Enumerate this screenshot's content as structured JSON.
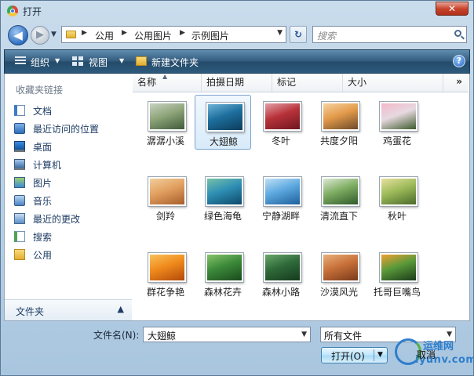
{
  "window": {
    "title": "打开",
    "close_glyph": "✕"
  },
  "nav_buttons": {
    "back_glyph": "◀",
    "forward_glyph": "▶",
    "history_glyph": "▼"
  },
  "address": {
    "arrow_glyph": "▶",
    "crumbs": [
      "公用",
      "公用图片",
      "示例图片"
    ],
    "dropdown_glyph": "▼",
    "refresh_glyph": "↻"
  },
  "search": {
    "placeholder": "搜索"
  },
  "toolbar": {
    "organize_label": "组织",
    "view_label": "视图",
    "new_folder_label": "新建文件夹",
    "caret_glyph": "▼",
    "help_glyph": "?"
  },
  "nav_pane": {
    "favorites_header": "收藏夹链接",
    "items": [
      {
        "label": "文档",
        "icon": "documents-icon"
      },
      {
        "label": "最近访问的位置",
        "icon": "recent-places-icon"
      },
      {
        "label": "桌面",
        "icon": "desktop-icon"
      },
      {
        "label": "计算机",
        "icon": "computer-icon"
      },
      {
        "label": "图片",
        "icon": "pictures-icon"
      },
      {
        "label": "音乐",
        "icon": "music-icon"
      },
      {
        "label": "最近的更改",
        "icon": "recent-changes-icon"
      },
      {
        "label": "搜索",
        "icon": "searches-icon"
      },
      {
        "label": "公用",
        "icon": "public-folder-icon"
      }
    ],
    "folders_label": "文件夹",
    "folders_caret": "▲"
  },
  "columns": {
    "headers": [
      "名称",
      "拍摄日期",
      "标记",
      "大小"
    ],
    "sort_glyph": "▲",
    "more_glyph": "»"
  },
  "files": [
    {
      "name": "潺潺小溪",
      "colors": [
        "#8fa57a",
        "#3f5b3a",
        "#c7d2c1"
      ]
    },
    {
      "name": "大翅鲸",
      "colors": [
        "#1e6f9e",
        "#0c3c5c",
        "#6fb4d8"
      ],
      "selected": true
    },
    {
      "name": "冬叶",
      "colors": [
        "#b8323a",
        "#6e1620",
        "#e3a0a6"
      ]
    },
    {
      "name": "共度夕阳",
      "colors": [
        "#e39a4a",
        "#6d4a2a",
        "#f6d3a0"
      ]
    },
    {
      "name": "鸡蛋花",
      "colors": [
        "#e7d9e0",
        "#3d5a2c",
        "#f2b8c8"
      ]
    },
    {
      "name": "剑羚",
      "colors": [
        "#e2a060",
        "#a85d2b",
        "#f1cf9d"
      ]
    },
    {
      "name": "绿色海龟",
      "colors": [
        "#2f8fb5",
        "#0d4a6a",
        "#77c2a8"
      ]
    },
    {
      "name": "宁静湖畔",
      "colors": [
        "#5da9df",
        "#1f5f9c",
        "#bfe0f5"
      ]
    },
    {
      "name": "清流直下",
      "colors": [
        "#7fae63",
        "#2f5a2a",
        "#dce8d2"
      ]
    },
    {
      "name": "秋叶",
      "colors": [
        "#9dbb5a",
        "#4b6a2a",
        "#e8e0a0"
      ]
    },
    {
      "name": "群花争艳",
      "colors": [
        "#f08a1c",
        "#b24a0a",
        "#f8c25a"
      ]
    },
    {
      "name": "森林花卉",
      "colors": [
        "#3c8a3a",
        "#1a4a1c",
        "#88c46a"
      ]
    },
    {
      "name": "森林小路",
      "colors": [
        "#2f6a3a",
        "#163a1c",
        "#6aa86a"
      ]
    },
    {
      "name": "沙漠风光",
      "colors": [
        "#c8703a",
        "#7a3a1a",
        "#e8b07a"
      ]
    },
    {
      "name": "托哥巨嘴鸟",
      "colors": [
        "#5a9a3a",
        "#1a3a1a",
        "#f0a030"
      ]
    }
  ],
  "bottom": {
    "filename_label": "文件名(N):",
    "filename_value": "大翅鲸",
    "filetype_value": "所有文件",
    "dropdown_glyph": "▼",
    "open_label": "打开(O)",
    "open_caret": "▼",
    "cancel_label": "取消"
  },
  "watermark": {
    "cn": "运维网",
    "url": "iyunv.com"
  }
}
